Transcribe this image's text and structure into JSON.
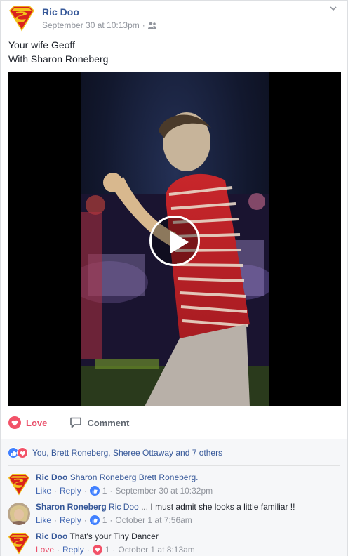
{
  "post": {
    "author": "Ric Doo",
    "timestamp": "September 30 at 10:13pm",
    "audience_icon": "friends-icon",
    "text_line1": "Your wife Geoff",
    "text_line2": "With Sharon Roneberg"
  },
  "video": {
    "play_icon": "play-icon"
  },
  "actions": {
    "love_label": "Love",
    "comment_label": "Comment"
  },
  "reactions": {
    "summary": "You, Brett Roneberg, Sheree Ottaway and 7 others"
  },
  "comments": [
    {
      "author": "Ric Doo",
      "tags": "Sharon Roneberg Brett Roneberg.",
      "text": "",
      "action_label": "Like",
      "reply_label": "Reply",
      "reaction_count": "1",
      "timestamp": "September 30 at 10:32pm",
      "reaction_type": "like"
    },
    {
      "author": "Sharon Roneberg",
      "tags": "Ric Doo",
      "text": "... I must admit she looks a little familiar !!",
      "action_label": "Like",
      "reply_label": "Reply",
      "reaction_count": "1",
      "timestamp": "October 1 at 7:56am",
      "reaction_type": "like"
    },
    {
      "author": "Ric Doo",
      "tags": "",
      "text": "That's your Tiny Dancer",
      "action_label": "Love",
      "reply_label": "Reply",
      "reaction_count": "1",
      "timestamp": "October 1 at 8:13am",
      "reaction_type": "love"
    }
  ],
  "colors": {
    "link_blue": "#365899",
    "love_red": "#e94f6a",
    "meta_gray": "#90949c"
  }
}
